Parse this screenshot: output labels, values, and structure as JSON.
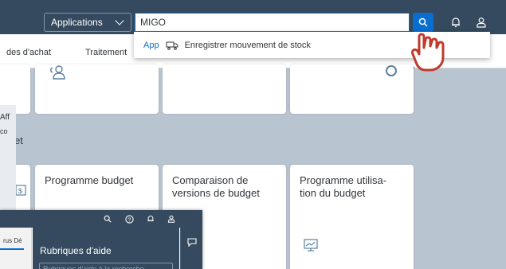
{
  "header": {
    "app_selector_label": "Applications",
    "search_value": "MIGO"
  },
  "tabs": [
    {
      "label": "des d'achat"
    },
    {
      "label": "Traitement"
    }
  ],
  "suggestion": {
    "type_label": "App",
    "text": "Enregistrer mouvement de stock"
  },
  "section": {
    "title": "et"
  },
  "tiles": [
    {
      "title": "Programme budget"
    },
    {
      "title": "Comparaison de\nversions de budget"
    },
    {
      "title": "Programme utilisa-\ntion du budget"
    }
  ],
  "left_fragment": {
    "line1": "Aff",
    "line2": "co"
  },
  "help_panel": {
    "tab_label": "rus Dé",
    "title": "Rubriques d'aide",
    "search_placeholder": "Rubriques d'aide à la recherche"
  },
  "colors": {
    "shell": "#354a5f",
    "accent": "#0a6ed1",
    "background": "#b8c4d0"
  },
  "icons": [
    "search-icon",
    "bell-icon",
    "user-icon",
    "chevron-down-icon",
    "help-icon",
    "chat-icon",
    "chart-icon",
    "pointer-hand-icon"
  ]
}
